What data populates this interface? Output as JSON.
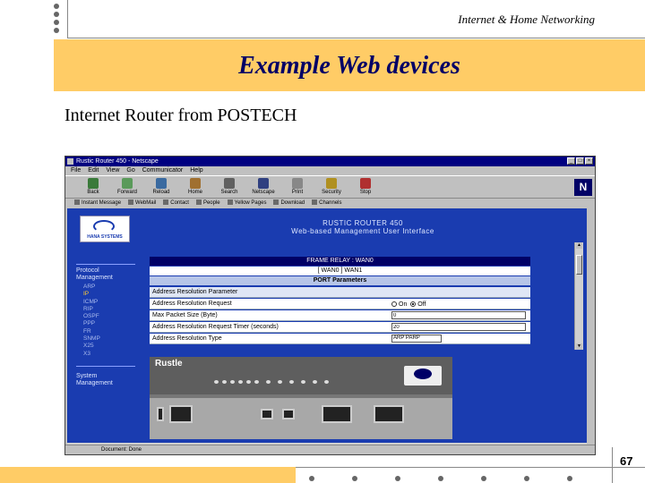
{
  "slide": {
    "header": "Internet & Home Networking",
    "title": "Example Web devices",
    "subtitle": "Internet Router from POSTECH",
    "page_number": "67",
    "accent_color": "#ffcc66",
    "title_color": "#000066"
  },
  "browser": {
    "window_title": "Rustic Router 450 - Netscape",
    "menu": [
      "File",
      "Edit",
      "View",
      "Go",
      "Communicator",
      "Help"
    ],
    "toolbar": [
      {
        "label": "Back",
        "icon": "back-arrow-icon"
      },
      {
        "label": "Forward",
        "icon": "forward-arrow-icon"
      },
      {
        "label": "Reload",
        "icon": "reload-icon"
      },
      {
        "label": "Home",
        "icon": "home-icon"
      },
      {
        "label": "Search",
        "icon": "search-icon"
      },
      {
        "label": "Netscape",
        "icon": "netscape-icon"
      },
      {
        "label": "Print",
        "icon": "print-icon"
      },
      {
        "label": "Security",
        "icon": "security-lock-icon"
      },
      {
        "label": "Stop",
        "icon": "stop-icon"
      }
    ],
    "directory_bar": [
      "Instant Message",
      "WebMail",
      "Contact",
      "People",
      "Yellow Pages",
      "Download",
      "Channels"
    ],
    "status_text": "Document: Done"
  },
  "router_page": {
    "banner_line1": "RUSTIC ROUTER 450",
    "banner_line2": "Web-based Management User Interface",
    "logo_text": "HANA SYSTEMS",
    "nav_section1": "Protocol Management",
    "nav_items": [
      "ARP",
      "IP",
      "ICMP",
      "RIP",
      "OSPF",
      "PPP",
      "FR",
      "SNMP",
      "X25",
      "X3"
    ],
    "nav_section2": "System Management",
    "frame_relay": "FRAME RELAY : WAN0",
    "wan_port": "[ WAN0 ]  WAN1",
    "port_parameters": "PORT Parameters",
    "section_header": "Address Resolution Parameter",
    "fields": [
      {
        "label": "Address Resolution Request",
        "type": "radio",
        "options": [
          "On",
          "Off"
        ],
        "selected": "Off"
      },
      {
        "label": "Max Packet Size (Byte)",
        "type": "input",
        "value": "0"
      },
      {
        "label": "Address Resolution Request Timer (seconds)",
        "type": "input",
        "value": "20"
      },
      {
        "label": "Address Resolution Type",
        "type": "select",
        "value": "ARP PARP"
      }
    ],
    "device_brand": "Rustle"
  }
}
